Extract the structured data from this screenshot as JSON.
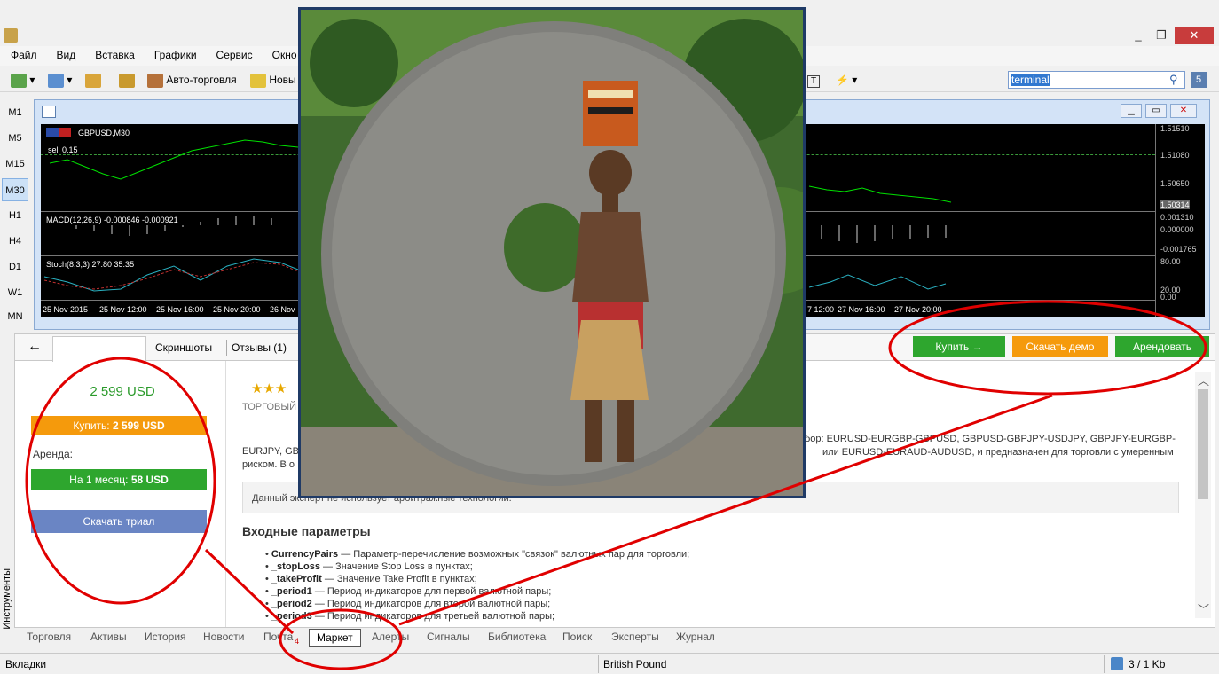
{
  "menu": [
    "Файл",
    "Вид",
    "Вставка",
    "Графики",
    "Сервис",
    "Окно"
  ],
  "toolbar": {
    "auto_trading": "Авто-торговля",
    "new_order": "Новы",
    "search_value": "terminal",
    "search_badge": "5"
  },
  "timeframes": [
    "M1",
    "M5",
    "M15",
    "M30",
    "H1",
    "H4",
    "D1",
    "W1",
    "MN"
  ],
  "active_timeframe": "M30",
  "chart": {
    "symbol": "GBPUSD,M30",
    "trade_label": "sell 0.15",
    "macd_label": "MACD(12,26,9) -0.000846 -0.000921",
    "stoch_label": "Stoch(8,3,3) 27.80 35.35",
    "price_levels": [
      "1.51510",
      "1.51080",
      "1.50650",
      "1.50314"
    ],
    "macd_levels": [
      "0.001310",
      "0.000000",
      "-0.001765"
    ],
    "stoch_levels": [
      "80.00",
      "20.00",
      "0.00"
    ],
    "time_labels_left": [
      "25 Nov 2015",
      "25 Nov 12:00",
      "25 Nov 16:00",
      "25 Nov 20:00",
      "26 Nov"
    ],
    "time_labels_right": [
      "7 12:00",
      "27 Nov 16:00",
      "27 Nov 20:00"
    ]
  },
  "market": {
    "back": "←",
    "tabs": [
      "Скриншоты",
      "Отзывы (1)"
    ],
    "buy_button": "Купить  →",
    "demo_button": "Скачать демо",
    "rent_button": "Арендовать",
    "price": "2 599 USD",
    "buy_price_prefix": "Купить: ",
    "buy_price_value": "2 599 USD",
    "rent_label": "Аренда:",
    "rent_month_prefix": "На 1 месяц: ",
    "rent_month_value": "58 USD",
    "trial_button": "Скачать триал",
    "category": "ТОРГОВЫЙ",
    "desc_right1": "бор: EURUSD-EURGBP-GBPUSD, GBPUSD-GBPJPY-USDJPY, GBPJPY-EURGBP-",
    "desc_left1": "EURJPY, GB",
    "desc_right2": "или EURUSD-EURAUD-AUDUSD, и предназначен для торговли с умеренным",
    "desc_left2": "риском. В о",
    "note": "Данный эксперт не использует арбитражные технологии.",
    "params_title": "Входные параметры",
    "params": [
      {
        "name": "CurrencyPairs",
        "desc": " — Параметр-перечисление возможных \"связок\" валютных пар для торговли;"
      },
      {
        "name": "_stopLoss",
        "desc": " — Значение Stop Loss в пунктах;"
      },
      {
        "name": "_takeProfit",
        "desc": " — Значение Take Profit в пунктах;"
      },
      {
        "name": "_period1",
        "desc": " — Период индикаторов для первой валютной пары;"
      },
      {
        "name": "_period2",
        "desc": " — Период индикаторов для второй валютной пары;"
      },
      {
        "name": "_period3",
        "desc": " — Период индикаторов для третьей валютной пары;"
      }
    ]
  },
  "side_label": "Инструменты",
  "bottom_tabs": [
    "Торговля",
    "Активы",
    "История",
    "Новости",
    "Почта",
    "Маркет",
    "Алерты",
    "Сигналы",
    "Библиотека",
    "Поиск",
    "Эксперты",
    "Журнал"
  ],
  "mail_badge": "4",
  "active_bottom_tab": "Маркет",
  "status": {
    "left": "Вкладки",
    "symbol": "British Pound",
    "traffic": "3 / 1 Kb"
  },
  "colors": {
    "buy_green": "#2ea62e",
    "demo_orange": "#f59a0c",
    "rent_green": "#2ea62e",
    "price_green": "#2a9a2a",
    "annotation_red": "#e00000"
  }
}
